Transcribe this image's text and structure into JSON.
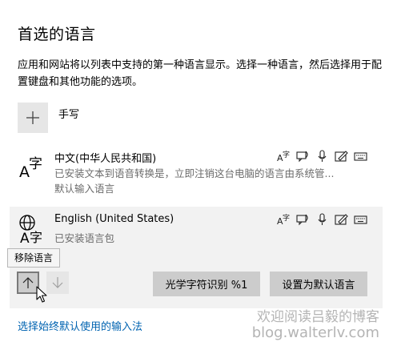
{
  "header": {
    "title": "首选的语言",
    "description": "应用和网站将以列表中支持的第一种语言显示。选择一种语言，然后选择用于配置键盘和其他功能的选项。"
  },
  "add_language": {
    "label": "手写",
    "icon": "plus-icon"
  },
  "languages": [
    {
      "name": "中文(中华人民共和国)",
      "line1": "已安装文本到语音转换是，立即注销这台电脑的语言由系统管...",
      "line2": "默认输入语言",
      "glyph_text": "字",
      "features": [
        "language-pack-icon",
        "speech-icon",
        "microphone-icon",
        "handwriting-icon",
        "keyboard-icon"
      ]
    },
    {
      "name": "English (United States)",
      "line1": "已安装语言包",
      "glyph_text": "字",
      "features": [
        "language-pack-icon",
        "speech-icon",
        "microphone-icon",
        "handwriting-icon",
        "keyboard-icon"
      ]
    }
  ],
  "tooltip": "移除语言",
  "controls": {
    "move_up": "move-up-icon",
    "move_down": "move-down-icon",
    "ocr_button": "光学字符识别 %1",
    "set_default_button": "设置为默认语言"
  },
  "footer_link": "选择始终默认使用的输入法",
  "watermark": {
    "line1": "欢迎阅读吕毅的博客",
    "line2": "blog.walterlv.com"
  },
  "colors": {
    "accent_link": "#0063b1",
    "selected_row": "#f2f2f2",
    "button_bg": "#cccccc",
    "secondary_text": "#6b6b6b"
  }
}
